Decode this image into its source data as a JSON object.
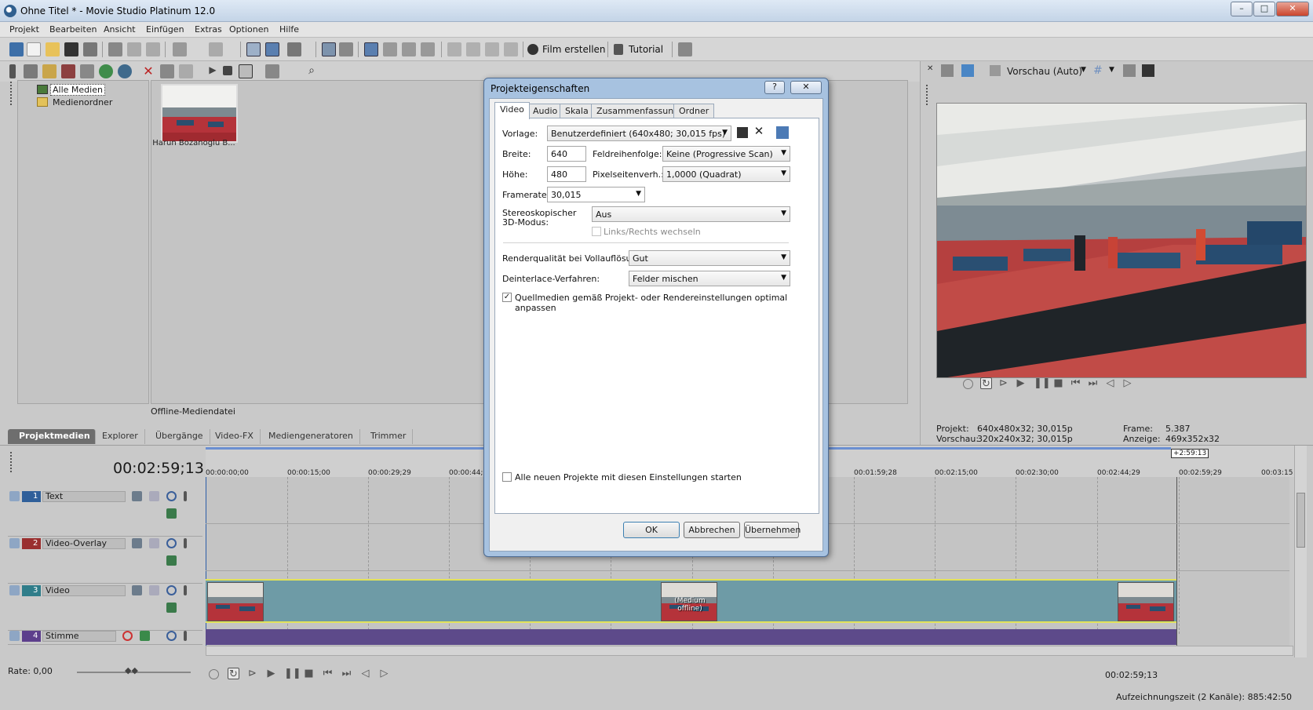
{
  "window": {
    "title": "Ohne Titel * - Movie Studio Platinum 12.0",
    "min": "–",
    "max": "□",
    "close": "✕"
  },
  "menu": [
    "Projekt",
    "Bearbeiten",
    "Ansicht",
    "Einfügen",
    "Extras",
    "Optionen",
    "Hilfe"
  ],
  "toolbar": {
    "film_erstellen": "Film erstellen",
    "tutorial": "Tutorial"
  },
  "explorer": {
    "tree": [
      "Alle Medien",
      "Medienordner"
    ],
    "media_item": "Harun Bozanoglu B...",
    "status": "Offline-Mediendatei"
  },
  "tabs": [
    "Projektmedien",
    "Explorer",
    "Übergänge",
    "Video-FX",
    "Mediengeneratoren",
    "Trimmer"
  ],
  "preview": {
    "mode": "Vorschau (Auto)",
    "projekt_label": "Projekt:",
    "projekt_value": "640x480x32; 30,015p",
    "vorschau_label": "Vorschau:",
    "vorschau_value": "320x240x32; 30,015p",
    "frame_label": "Frame:",
    "frame_value": "5.387",
    "anzeige_label": "Anzeige:",
    "anzeige_value": "469x352x32"
  },
  "timeline": {
    "timecode": "00:02:59;13",
    "end_marker": "+2:59:13",
    "ruler": [
      "00:00:00;00",
      "00:00:15;00",
      "00:00:29;29",
      "00:00:44;2",
      "00:01:59;28",
      "00:02:15;00",
      "00:02:30;00",
      "00:02:44;29",
      "00:02:59;29",
      "00:03:15"
    ],
    "tracks": [
      {
        "num": "1",
        "name": "Text",
        "color": "#2f5f9a"
      },
      {
        "num": "2",
        "name": "Video-Overlay",
        "color": "#9a2f2f"
      },
      {
        "num": "3",
        "name": "Video",
        "color": "#2f7d8a"
      },
      {
        "num": "4",
        "name": "Stimme",
        "color": "#5d3f8c"
      }
    ],
    "offline_label": "(Medium offline)",
    "rate": "Rate: 0,00",
    "cursor_time": "00:02:59;13",
    "record_time": "Aufzeichnungszeit (2 Kanäle): 885:42:50"
  },
  "dialog": {
    "title": "Projekteigenschaften",
    "help": "?",
    "close": "✕",
    "tabs": [
      "Video",
      "Audio",
      "Skala",
      "Zusammenfassung",
      "Ordner"
    ],
    "vorlage_label": "Vorlage:",
    "vorlage_value": "Benutzerdefiniert (640x480; 30,015 fps)",
    "breite_label": "Breite:",
    "breite_value": "640",
    "hoehe_label": "Höhe:",
    "hoehe_value": "480",
    "feldreihenfolge_label": "Feldreihenfolge:",
    "feldreihenfolge_value": "Keine (Progressive Scan)",
    "pixelseitenverh_label": "Pixelseitenverh.:",
    "pixelseitenverh_value": "1,0000 (Quadrat)",
    "framerate_label": "Framerate:",
    "framerate_value": "30,015",
    "stereo_label_1": "Stereoskopischer",
    "stereo_label_2": "3D-Modus:",
    "stereo_value": "Aus",
    "links_rechts": "Links/Rechts wechseln",
    "renderqualitaet_label": "Renderqualität bei Vollauflösung:",
    "renderqualitaet_value": "Gut",
    "deinterlace_label": "Deinterlace-Verfahren:",
    "deinterlace_value": "Felder mischen",
    "quellmedien": "Quellmedien gemäß Projekt- oder Rendereinstellungen optimal anpassen",
    "quellmedien_checked": "✓",
    "alle_neuen": "Alle neuen Projekte mit diesen Einstellungen starten",
    "ok": "OK",
    "abbrechen": "Abbrechen",
    "uebernehmen": "Übernehmen"
  }
}
